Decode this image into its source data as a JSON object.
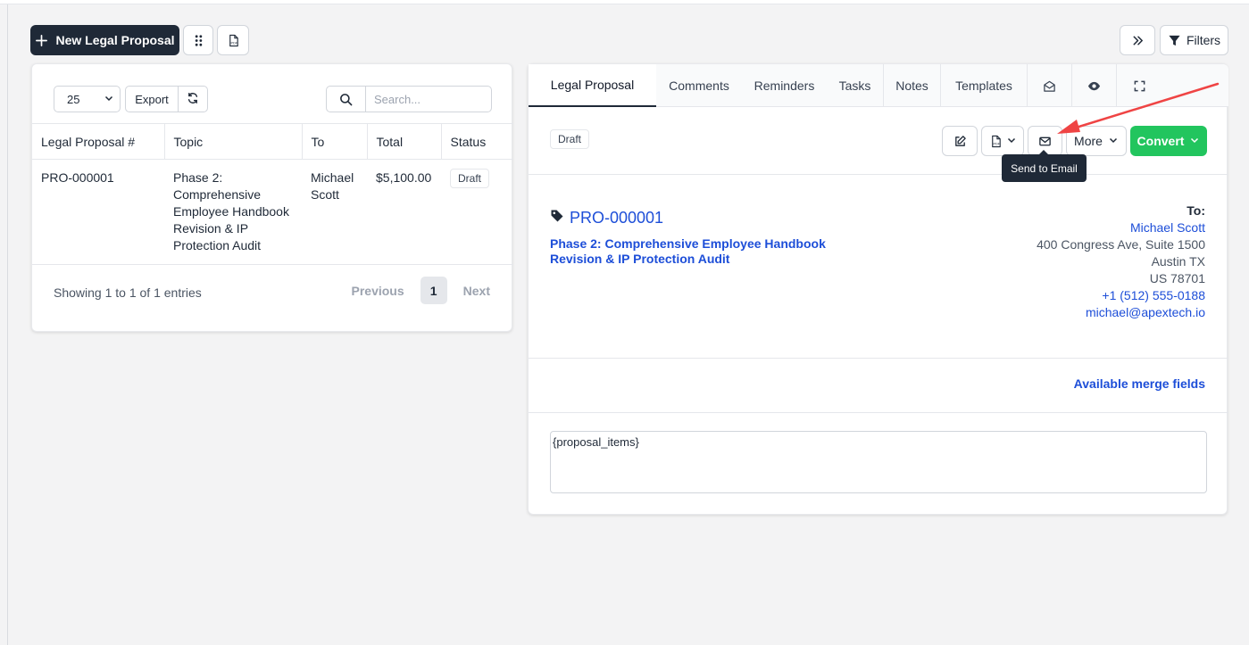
{
  "toolbar": {
    "new_button_label": "New Legal Proposal",
    "filters_label": "Filters",
    "icons": {
      "add": "plus-icon",
      "grid": "grid-dots-icon",
      "pdf": "pdf-file-icon",
      "expand": "double-chevron-right-icon",
      "filter": "filter-icon"
    }
  },
  "list": {
    "per_page": "25",
    "export_label": "Export",
    "search_placeholder": "Search...",
    "columns": [
      "Legal Proposal #",
      "Topic",
      "To",
      "Total",
      "Status"
    ],
    "rows": [
      {
        "number": "PRO-000001",
        "topic": "Phase 2: Comprehensive Employee Handbook Revision & IP Protection Audit",
        "to": "Michael Scott",
        "total": "$5,100.00",
        "status": "Draft"
      }
    ],
    "footer_info": "Showing 1 to 1 of 1 entries",
    "pagination": {
      "previous": "Previous",
      "current": "1",
      "next": "Next"
    }
  },
  "detail": {
    "tabs": [
      "Legal Proposal",
      "Comments",
      "Reminders",
      "Tasks",
      "Notes",
      "Templates"
    ],
    "tab_icons": [
      "envelope-open-icon",
      "eye-icon",
      "fullscreen-icon"
    ],
    "status": "Draft",
    "actions": {
      "more_label": "More",
      "convert_label": "Convert"
    },
    "tooltip": "Send to Email",
    "proposal_number": "PRO-000001",
    "subject_line1": "Phase 2: Comprehensive Employee Handbook",
    "subject_line2": "Revision & IP Protection Audit",
    "to": {
      "label": "To:",
      "name": "Michael Scott",
      "address": "400 Congress Ave, Suite 1500",
      "city": "Austin TX",
      "country_zip": "US 78701",
      "phone": "+1 (512) 555-0188",
      "email": "michael@apextech.io"
    },
    "merge_fields_label": "Available merge fields",
    "items_placeholder": "{proposal_items}"
  },
  "colors": {
    "primary_dark": "#1f2937",
    "link_blue": "#1d4ed8",
    "convert_green": "#22c55e",
    "annotation_red": "#ef4444"
  }
}
